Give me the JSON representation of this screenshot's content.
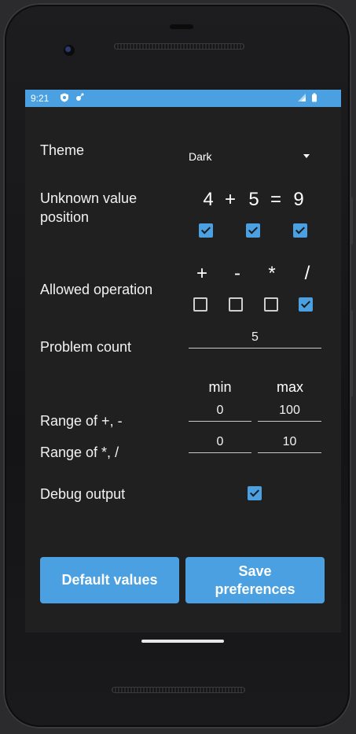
{
  "status_bar": {
    "time": "9:21",
    "icons": [
      "shield-icon",
      "cast-icon",
      "signal-icon",
      "battery-icon"
    ],
    "color": "#4aa0e0"
  },
  "settings": {
    "theme": {
      "label": "Theme",
      "value": "Dark"
    },
    "unknown_position": {
      "label": "Unknown value position",
      "equation": [
        "4",
        "+",
        "5",
        "=",
        "9"
      ],
      "checked": [
        true,
        true,
        true
      ]
    },
    "allowed_operation": {
      "label": "Allowed operation",
      "operations": [
        "+",
        "-",
        "*",
        "/"
      ],
      "checked": [
        false,
        false,
        false,
        true
      ]
    },
    "problem_count": {
      "label": "Problem count",
      "value": "5"
    },
    "range_headers": {
      "min": "min",
      "max": "max"
    },
    "range_add_sub": {
      "label": "Range of +, -",
      "min": "0",
      "max": "100"
    },
    "range_mul_div": {
      "label": "Range of *, /",
      "min": "0",
      "max": "10"
    },
    "debug_output": {
      "label": "Debug output",
      "checked": true
    }
  },
  "buttons": {
    "default_values": "Default values",
    "save_preferences": "Save preferences"
  },
  "colors": {
    "accent": "#4aa0e0",
    "background": "#202020"
  }
}
